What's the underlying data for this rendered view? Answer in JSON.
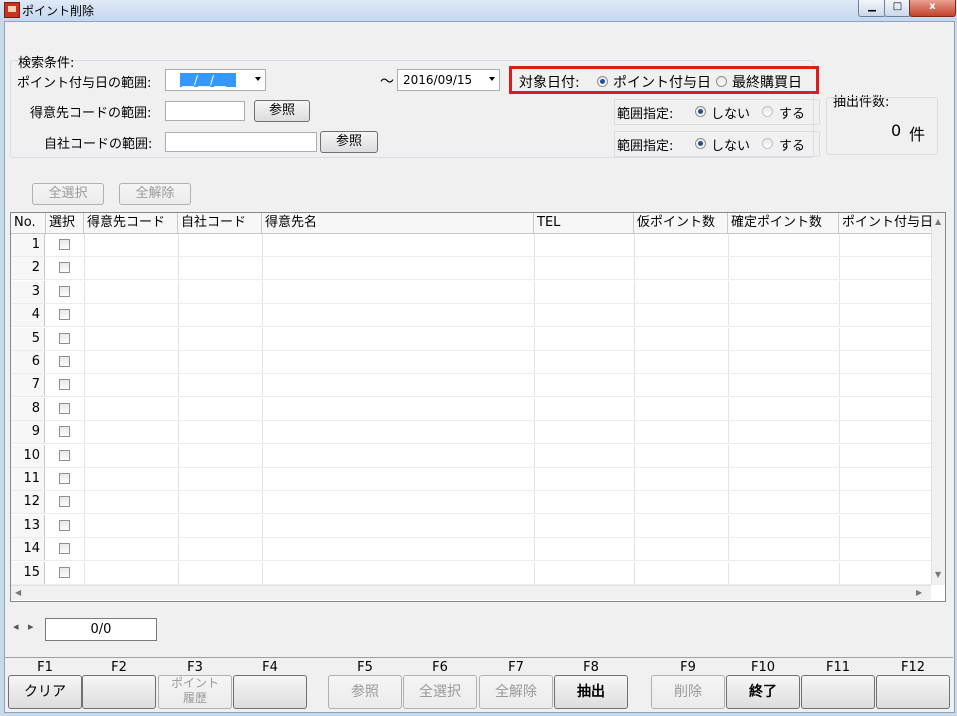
{
  "window": {
    "title": "ポイント削除",
    "minimize_glyph": "▁",
    "maximize_glyph": "□",
    "close_glyph": "x"
  },
  "search": {
    "group_title": "検索条件:",
    "point_date_label": "ポイント付与日の範囲:",
    "date_from_value": "__/__/__",
    "tilde": "〜",
    "date_to_value": "2016/09/15",
    "customer_code_label": "得意先コードの範囲:",
    "customer_code_value": "",
    "ref_button_1": "参照",
    "company_code_label": "自社コードの範囲:",
    "company_code_value": "",
    "ref_button_2": "参照"
  },
  "target_date": {
    "label": "対象日付:",
    "option_point": "ポイント付与日",
    "option_purchase": "最終購買日",
    "selected": "ポイント付与日"
  },
  "range_1": {
    "label": "範囲指定:",
    "option_no": "しない",
    "option_yes": "する",
    "selected": "しない"
  },
  "range_2": {
    "label": "範囲指定:",
    "option_no": "しない",
    "option_yes": "する",
    "selected": "しない"
  },
  "extract": {
    "label": "抽出件数:",
    "count": "0",
    "unit": "件"
  },
  "selection": {
    "select_all": "全選択",
    "deselect_all": "全解除"
  },
  "grid": {
    "columns": [
      "No.",
      "選択",
      "得意先コード",
      "自社コード",
      "得意先名",
      "TEL",
      "仮ポイント数",
      "確定ポイント数",
      "ポイント付与日"
    ],
    "rows": [
      "1",
      "2",
      "3",
      "4",
      "5",
      "6",
      "7",
      "8",
      "9",
      "10",
      "11",
      "12",
      "13",
      "14",
      "15"
    ]
  },
  "pager": {
    "value": "0/0",
    "prev": "◂",
    "next": "▸"
  },
  "fkeys": [
    {
      "key": "F1",
      "label": "クリア",
      "enabled": true
    },
    {
      "key": "F2",
      "label": "",
      "enabled": true
    },
    {
      "key": "F3",
      "label": "ポイント\n履歴",
      "enabled": false
    },
    {
      "key": "F4",
      "label": "",
      "enabled": true
    },
    {
      "key": "F5",
      "label": "参照",
      "enabled": false
    },
    {
      "key": "F6",
      "label": "全選択",
      "enabled": false
    },
    {
      "key": "F7",
      "label": "全解除",
      "enabled": false
    },
    {
      "key": "F8",
      "label": "抽出",
      "enabled": true
    },
    {
      "key": "F9",
      "label": "削除",
      "enabled": false
    },
    {
      "key": "F10",
      "label": "終了",
      "enabled": true
    },
    {
      "key": "F11",
      "label": "",
      "enabled": true
    },
    {
      "key": "F12",
      "label": "",
      "enabled": true
    }
  ],
  "colors": {
    "highlight_box": "#d81e1e",
    "selection": "#3399ff",
    "radio_dot": "#1f4f9b"
  }
}
